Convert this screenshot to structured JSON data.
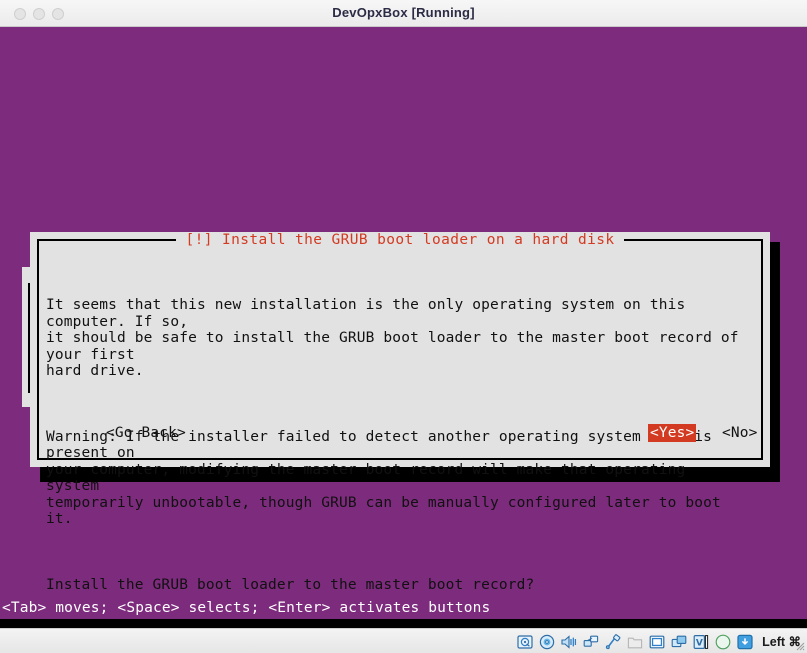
{
  "window": {
    "title": "DevOpxBox [Running]",
    "controls": [
      {
        "name": "close",
        "color": "#e4e4e4"
      },
      {
        "name": "minimize",
        "color": "#e4e4e4"
      },
      {
        "name": "maximize",
        "color": "#e4e4e4"
      }
    ]
  },
  "guest": {
    "background_color": "#7d2b7d",
    "hint_line": "<Tab> moves; <Space> selects; <Enter> activates buttons"
  },
  "dialog": {
    "title": "[!] Install the GRUB boot loader on a hard disk",
    "title_color": "#d33a22",
    "background_color": "#e2e2e2",
    "paragraphs": [
      "It seems that this new installation is the only operating system on this computer. If so,\nit should be safe to install the GRUB boot loader to the master boot record of your first\nhard drive.",
      "Warning: If the installer failed to detect another operating system that is present on\nyour computer, modifying the master boot record will make that operating system\ntemporarily unbootable, though GRUB can be manually configured later to boot it.",
      "Install the GRUB boot loader to the master boot record?"
    ],
    "buttons": [
      {
        "label": "<Go Back>",
        "selected": false
      },
      {
        "label": "<Yes>",
        "selected": true
      },
      {
        "label": "<No>",
        "selected": false
      }
    ],
    "selected_button": "<Yes>",
    "highlight_color": "#d33a22"
  },
  "statusbar": {
    "icons": [
      "hard-disk-icon",
      "optical-disk-icon",
      "audio-icon",
      "network-icon",
      "usb-icon",
      "shared-folders-icon",
      "display-icon",
      "remote-desktop-icon",
      "virtualization-icon",
      "mouse-integration-icon",
      "host-key-icon"
    ],
    "host_key_label": "Left ⌘"
  }
}
